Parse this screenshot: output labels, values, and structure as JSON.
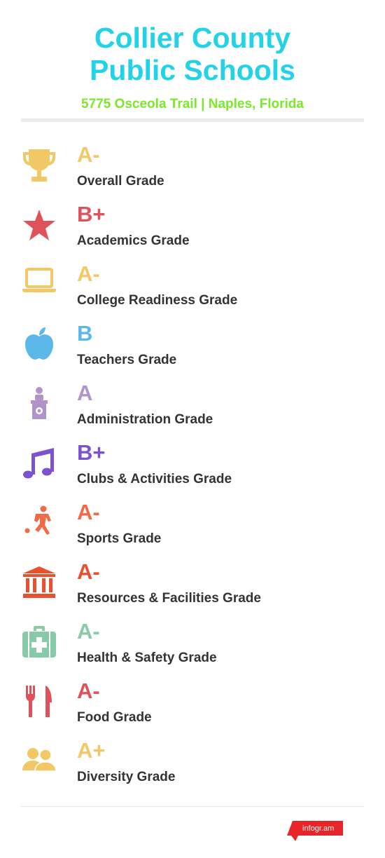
{
  "header": {
    "title_line1": "Collier County",
    "title_line2": "Public Schools",
    "address": "5775 Osceola Trail | Naples, Florida"
  },
  "colors": {
    "title": "#22d3e6",
    "address": "#7be82b",
    "label": "#333333",
    "brand": "#e8262a"
  },
  "grades": [
    {
      "grade": "A-",
      "label": "Overall Grade",
      "icon": "trophy-icon",
      "color": "#f2c867"
    },
    {
      "grade": "B+",
      "label": "Academics Grade",
      "icon": "star-icon",
      "color": "#e0525a"
    },
    {
      "grade": "A-",
      "label": "College Readiness Grade",
      "icon": "laptop-icon",
      "color": "#f2c867"
    },
    {
      "grade": "B",
      "label": "Teachers Grade",
      "icon": "apple-icon",
      "color": "#5bb8e8"
    },
    {
      "grade": "A",
      "label": "Administration Grade",
      "icon": "podium-icon",
      "color": "#b093c9"
    },
    {
      "grade": "B+",
      "label": "Clubs & Activities Grade",
      "icon": "music-note-icon",
      "color": "#7b52cf"
    },
    {
      "grade": "A-",
      "label": "Sports Grade",
      "icon": "soccer-player-icon",
      "color": "#f26a45"
    },
    {
      "grade": "A-",
      "label": "Resources & Facilities Grade",
      "icon": "building-icon",
      "color": "#e8502e"
    },
    {
      "grade": "A-",
      "label": "Health & Safety Grade",
      "icon": "first-aid-kit-icon",
      "color": "#88c9a8"
    },
    {
      "grade": "A-",
      "label": "Food Grade",
      "icon": "fork-knife-icon",
      "color": "#e0525a"
    },
    {
      "grade": "A+",
      "label": "Diversity Grade",
      "icon": "people-icon",
      "color": "#f2c867"
    }
  ],
  "footer": {
    "brand": "infogr.am"
  }
}
